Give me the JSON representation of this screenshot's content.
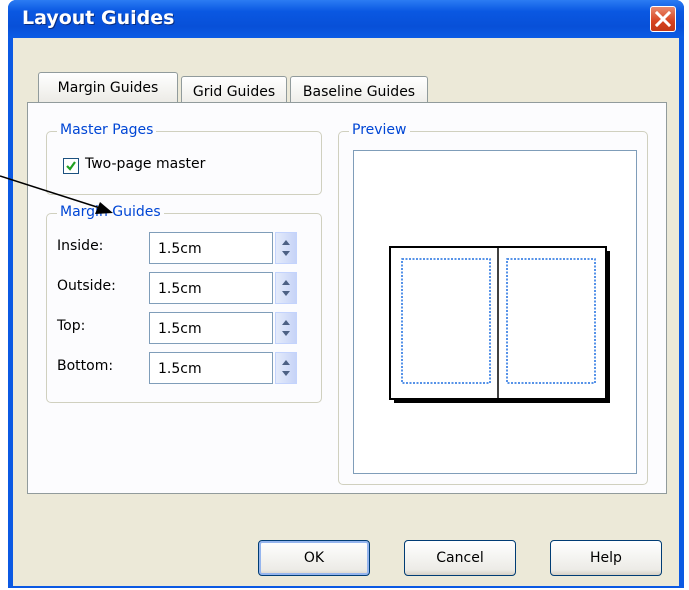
{
  "window": {
    "title": "Layout Guides"
  },
  "tabs": [
    {
      "label": "Margin Guides",
      "active": true
    },
    {
      "label": "Grid Guides",
      "active": false
    },
    {
      "label": "Baseline Guides",
      "active": false
    }
  ],
  "master_pages": {
    "legend": "Master Pages",
    "two_page_master": {
      "label": "Two-page master",
      "checked": true
    }
  },
  "margin_guides": {
    "legend": "Margin Guides",
    "fields": [
      {
        "label": "Inside:",
        "value": "1.5cm"
      },
      {
        "label": "Outside:",
        "value": "1.5cm"
      },
      {
        "label": "Top:",
        "value": "1.5cm"
      },
      {
        "label": "Bottom:",
        "value": "1.5cm"
      }
    ]
  },
  "preview": {
    "legend": "Preview"
  },
  "buttons": {
    "ok": "OK",
    "cancel": "Cancel",
    "help": "Help"
  },
  "colors": {
    "title_bar": "#0a58e2",
    "legend_text": "#0046d5",
    "margin_line": "#1e6fe0",
    "close_button": "#d7431f"
  }
}
